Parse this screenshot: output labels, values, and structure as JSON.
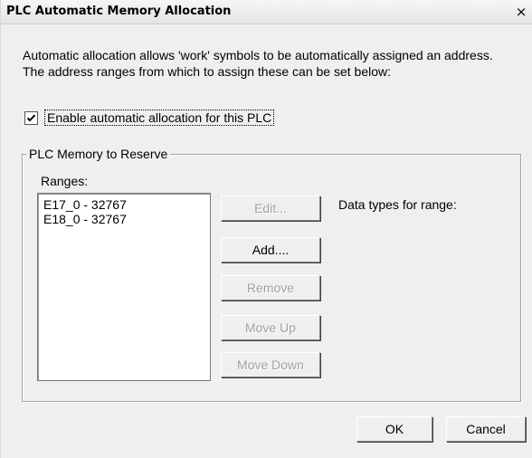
{
  "window": {
    "title": "PLC Automatic Memory Allocation",
    "close_glyph": "×"
  },
  "description": {
    "line1": "Automatic allocation allows 'work' symbols to be automatically assigned an address.",
    "line2": "The address ranges from which to assign these can be set below:"
  },
  "enable_checkbox": {
    "label": "Enable automatic allocation for this PLC",
    "checked": true
  },
  "group": {
    "title": "PLC Memory to Reserve",
    "ranges_label": "Ranges:",
    "ranges": [
      "E17_0 - 32767",
      "E18_0 - 32767"
    ],
    "data_types_label": "Data types for range:"
  },
  "buttons": {
    "edit": "Edit...",
    "add": "Add....",
    "remove": "Remove",
    "move_up": "Move Up",
    "move_down": "Move Down",
    "ok": "OK",
    "cancel": "Cancel"
  },
  "button_states": {
    "edit": "disabled",
    "add": "enabled",
    "remove": "disabled",
    "move_up": "disabled",
    "move_down": "disabled",
    "ok": "enabled",
    "cancel": "enabled"
  }
}
